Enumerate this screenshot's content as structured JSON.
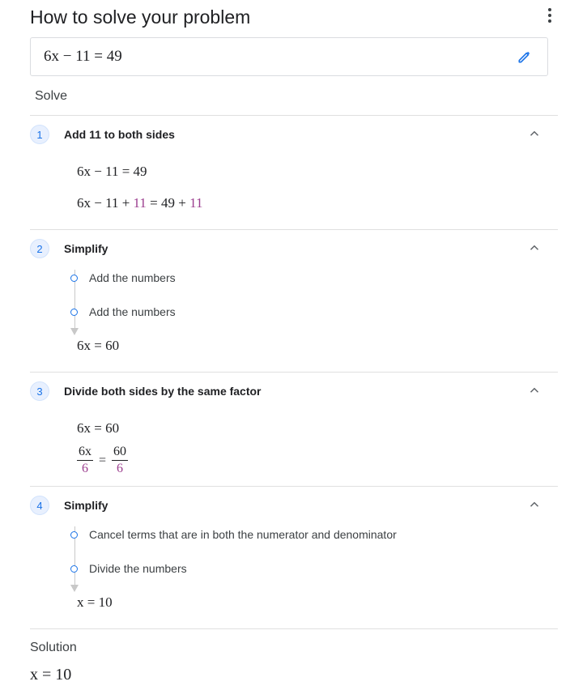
{
  "header": {
    "title": "How to solve your problem",
    "menu_icon": "more-vert-icon"
  },
  "problem": {
    "equation": "6x − 11 = 49",
    "edit_icon": "pencil-icon"
  },
  "solve_label": "Solve",
  "steps": [
    {
      "number": "1",
      "title": "Add 11 to both sides",
      "lines": [
        {
          "text": "6x − 11 = 49"
        },
        {
          "a": "6x − 11 + ",
          "b": "11",
          "c": " = 49 + ",
          "d": "11"
        }
      ]
    },
    {
      "number": "2",
      "title": "Simplify",
      "substeps": [
        "Add the numbers",
        "Add the numbers"
      ],
      "result": "6x = 60"
    },
    {
      "number": "3",
      "title": "Divide both sides by the same factor",
      "line1": "6x = 60",
      "fraction": {
        "left_num": "6x",
        "left_den": "6",
        "equals": "=",
        "right_num": "60",
        "right_den": "6"
      }
    },
    {
      "number": "4",
      "title": "Simplify",
      "substeps": [
        "Cancel terms that are in both the numerator and denominator",
        "Divide the numbers"
      ],
      "result": "x = 10"
    }
  ],
  "solution": {
    "label": "Solution",
    "equation": "x = 10"
  },
  "colors": {
    "accent": "#1a73e8",
    "highlight": "#9c3f8f",
    "divider": "#e0e0e0"
  }
}
